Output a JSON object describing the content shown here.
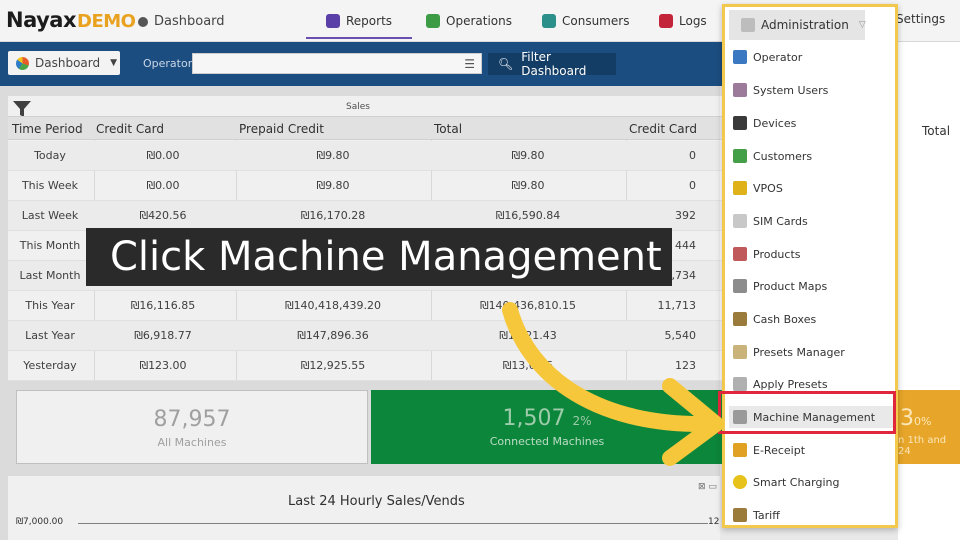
{
  "brand": {
    "name": "Nayax",
    "suffix": "DEMO"
  },
  "breadcrumb": "Dashboard",
  "nav": {
    "reports": "Reports",
    "operations": "Operations",
    "consumers": "Consumers",
    "logs": "Logs",
    "administration": "Administration",
    "settings": "Settings"
  },
  "filters": {
    "dashboard_button": "Dashboard",
    "operator_label": "Operator",
    "operator_value": "",
    "filter_button": "Filter Dashboard"
  },
  "table": {
    "group_header": "Sales",
    "headers": [
      "Time Period",
      "Credit Card",
      "Prepaid Credit",
      "Total",
      "Credit Card",
      "Total"
    ],
    "rows": [
      [
        "Today",
        "₪0.00",
        "₪9.80",
        "₪9.80",
        "0"
      ],
      [
        "This Week",
        "₪0.00",
        "₪9.80",
        "₪9.80",
        "0"
      ],
      [
        "Last Week",
        "₪420.56",
        "₪16,170.28",
        "₪16,590.84",
        "392"
      ],
      [
        "This Month",
        "",
        "",
        "",
        "444"
      ],
      [
        "Last Month",
        "",
        "",
        "",
        "1,734"
      ],
      [
        "This Year",
        "₪16,116.85",
        "₪140,418,439.20",
        "₪140,436,810.15",
        "11,713"
      ],
      [
        "Last Year",
        "₪6,918.77",
        "₪147,896.36",
        "₪1...21.43",
        "5,540"
      ],
      [
        "Yesterday",
        "₪123.00",
        "₪12,925.55",
        "₪13,0...5",
        "123"
      ]
    ]
  },
  "cards": {
    "machines_value": "87,957",
    "machines_label": "All Machines",
    "connected_value": "1,507",
    "connected_pct": "2%",
    "connected_label": "Connected Machines",
    "partial_value": "3",
    "partial_pct": "0%",
    "partial_label": "n 1th and 24"
  },
  "chart": {
    "title": "Last 24 Hourly Sales/Vends",
    "y_tick": "₪7,000.00",
    "right_tick": "12"
  },
  "menu": {
    "header": "Administration",
    "items": [
      "Operator",
      "System Users",
      "Devices",
      "Customers",
      "VPOS",
      "SIM Cards",
      "Products",
      "Product Maps",
      "Cash Boxes",
      "Presets Manager",
      "Apply Presets",
      "Machine Management",
      "E-Receipt",
      "Smart Charging",
      "Tariff"
    ]
  },
  "caption": "Click Machine Management",
  "colors": {
    "accent_blue": "#1c4d80",
    "green": "#0d8f3f",
    "highlight_red": "#e0263d",
    "arrow_yellow": "#f6c73a"
  }
}
